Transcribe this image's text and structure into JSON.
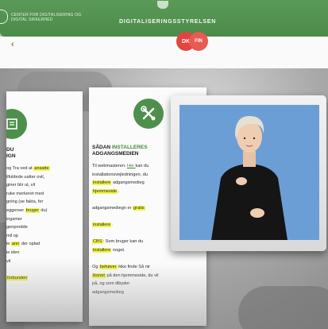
{
  "header": {
    "org_name": "CENTER FOR DIGITALISERING OG DIGITAL SIKKERHED",
    "site_title": "DIGITALISERINGSSTYRELSEN"
  },
  "share": {
    "label_1": "DK",
    "label_2": "FIN"
  },
  "left_card": {
    "heading_line_1": "DU",
    "heading_line_2": "IGN",
    "lines": [
      {
        "pre": "og Tra",
        "mid_text": "",
        "tail": " ved at ",
        "mark": "ansatte",
        "post": ""
      },
      {
        "pre": "ilfuldede uatter ovil,",
        "mid_text": "",
        "tail": "",
        "mark": "",
        "post": ""
      },
      {
        "pre": "giner blir ut, vil",
        "mid_text": "",
        "tail": "",
        "mark": "",
        "post": ""
      },
      {
        "pre": "ruke merkeret med",
        "mid_text": "",
        "tail": "",
        "mark": "",
        "post": ""
      },
      {
        "pre": "gning (se fakta, fer",
        "mid_text": "",
        "tail": "",
        "mark": "",
        "post": ""
      },
      {
        "pre": "eggerser ",
        "mid_text": "",
        "tail": "",
        "mark": "bruger",
        "post": " du)"
      },
      {
        "pre": "ingsmer ",
        "mid_text": "",
        "tail": "",
        "mark": "",
        "post": ""
      },
      {
        "pre": "genprodde",
        "mid_text": "",
        "tail": "",
        "mark": "",
        "post": ""
      },
      {
        "pre": "mil op",
        "mid_text": "",
        "tail": "",
        "mark": "",
        "post": ""
      },
      {
        "pre": "le ",
        "mid_text": "",
        "tail": "",
        "mark": "ann",
        "post": " der oplad"
      },
      {
        "pre": "ie iden",
        "mid_text": "",
        "tail": "",
        "mark": "",
        "post": ""
      },
      {
        "pre": "vil",
        "mid_text": "",
        "tail": "",
        "mark": "",
        "post": ""
      },
      {
        "pre": "",
        "mid_text": "",
        "tail": "",
        "mark": "",
        "post": ""
      },
      {
        "pre": "",
        "mid_text": "",
        "tail": "",
        "mark": "forbunden",
        "post": ""
      },
      {
        "pre": "",
        "mid_text": "",
        "tail": "",
        "mark": "",
        "post": ""
      }
    ]
  },
  "mid_card": {
    "heading_line_1_pre": "SÅDAN ",
    "heading_line_1_hl": "INSTALLERES",
    "heading_line_2": "ADGANGSMEDIEN",
    "lines": [
      {
        "pre": "Til webmasteren: ",
        "mark": "",
        "link": "Her ",
        "post": "kan du"
      },
      {
        "pre": "installationsvejledningen, du",
        "mark": "",
        "link": "",
        "post": ""
      },
      {
        "pre": "",
        "mark": "installere",
        "link": "",
        "post": " adgangsmedieg"
      },
      {
        "pre": "",
        "mark": "hjemmeside",
        "link": "",
        "post": "."
      },
      {
        "pre": "",
        "mark": "",
        "link": "",
        "post": ""
      },
      {
        "pre": "adgangsmediegn er ",
        "mark": "gratis",
        "link": "",
        "post": ""
      },
      {
        "pre": "",
        "mark": "",
        "link": "",
        "post": ""
      },
      {
        "pre": "",
        "mark": "installere",
        "link": "",
        "post": "."
      },
      {
        "pre": "",
        "mark": "",
        "link": "",
        "post": ""
      },
      {
        "pre": "",
        "mark": "CBS",
        "link": "",
        "post": ": Som bruger kan du"
      },
      {
        "pre": "",
        "mark": "installere",
        "link": "",
        "post": " noget."
      },
      {
        "pre": "",
        "mark": "",
        "link": "",
        "post": ""
      },
      {
        "pre": "Og ",
        "mark": "behøver",
        "link": "",
        "post": " ikke finde Så nir"
      },
      {
        "pre": "",
        "mark": "ikonet",
        "link": "",
        "post": " på den hjemmeside, du vil"
      },
      {
        "pre": "på, ",
        "mark": "",
        "link": "",
        "post": "og som tilbyder"
      },
      {
        "pre": "adgangsmedieg",
        "mark": "",
        "link": "",
        "post": ""
      }
    ]
  },
  "video": {
    "subject": "sign-language-interpreter",
    "background_color": "#6c9ed6"
  },
  "colors": {
    "brand_green": "#4f8f4d",
    "highlight_yellow": "#f1f54a",
    "share_red": "#e2453d"
  }
}
